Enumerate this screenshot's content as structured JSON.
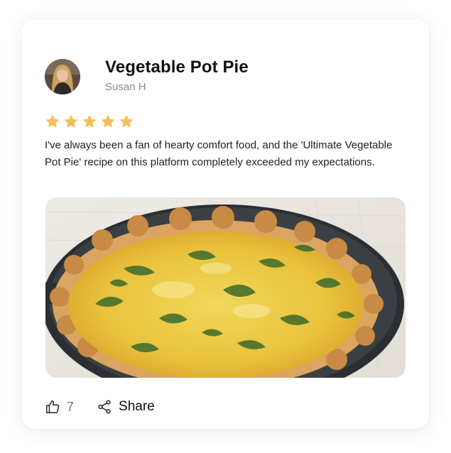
{
  "review": {
    "title": "Vegetable Pot Pie",
    "author": "Susan H",
    "rating": 5,
    "rating_max": 5,
    "body": "I've always been a fan of hearty comfort food, and the 'Ultimate Vegetable Pot Pie' recipe on this platform completely exceeded my expectations.",
    "like_count": "7",
    "share_label": "Share"
  },
  "icons": {
    "star": "star-icon",
    "like": "thumbs-up-icon",
    "share": "share-icon"
  },
  "colors": {
    "star": "#f7bd58",
    "title": "#111111",
    "author": "#8a8a8a",
    "count": "#777777"
  }
}
